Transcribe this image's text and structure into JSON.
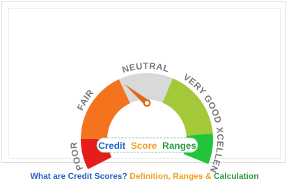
{
  "gauge": {
    "segments": [
      {
        "label": "POOR",
        "color": "#e51d1d"
      },
      {
        "label": "FAIR",
        "color": "#f4731c"
      },
      {
        "label": "NEUTRAL",
        "color": "#d9d9d9"
      },
      {
        "label": "VERY GOOD",
        "color": "#a3c93a"
      },
      {
        "label": "EXCELLENT",
        "color": "#22c439"
      }
    ],
    "label_color": "#7a7a7a",
    "needle_color": "#e0681c"
  },
  "badge": {
    "word1": "Credit",
    "word2": "Score",
    "word3": "Ranges",
    "colors": [
      "#2366c4",
      "#f0a020",
      "#2e9d44"
    ]
  },
  "caption": {
    "part1": "What are Credit Scores?",
    "part2": "Definition, Ranges",
    "part3": "&",
    "part4": "Calculation",
    "colors": [
      "#2366c4",
      "#f0a020",
      "#f0a020",
      "#2e9d44"
    ]
  }
}
